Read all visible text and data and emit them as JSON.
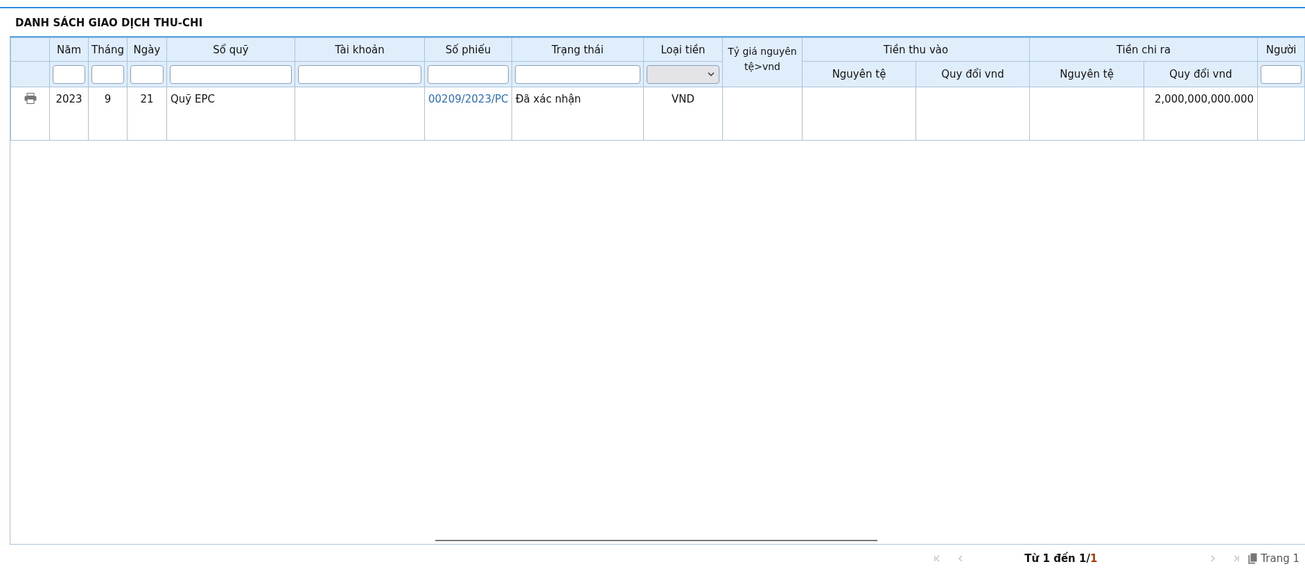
{
  "title": "DANH SÁCH GIAO DỊCH THU-CHI",
  "columns": [
    {
      "kind": "action"
    },
    {
      "kind": "text_filter",
      "label": "Năm"
    },
    {
      "kind": "text_filter",
      "label": "Tháng"
    },
    {
      "kind": "text_filter",
      "label": "Ngày"
    },
    {
      "kind": "text_filter",
      "label": "Sổ quỹ"
    },
    {
      "kind": "text_filter",
      "label": "Tài khoản"
    },
    {
      "kind": "text_filter",
      "label": "Số phiếu"
    },
    {
      "kind": "text_filter",
      "label": "Trạng thái"
    },
    {
      "kind": "select_filter",
      "label": "Loại tiền"
    },
    {
      "kind": "plain",
      "label": "Tỷ giá nguyên tệ>vnd"
    },
    {
      "kind": "group",
      "label": "Tiền thu vào",
      "children": [
        {
          "label": "Nguyên tệ"
        },
        {
          "label": "Quy đổi vnd"
        }
      ]
    },
    {
      "kind": "group",
      "label": "Tiền chi ra",
      "children": [
        {
          "label": "Nguyên tệ"
        },
        {
          "label": "Quy đổi vnd"
        }
      ]
    },
    {
      "kind": "text_filter",
      "label": "Người"
    }
  ],
  "rows": [
    {
      "cells": [
        {
          "kind": "print"
        },
        {
          "kind": "center",
          "text": "2023"
        },
        {
          "kind": "center",
          "text": "9"
        },
        {
          "kind": "center",
          "text": "21"
        },
        {
          "kind": "left",
          "text": "Quỹ EPC"
        },
        {
          "kind": "empty"
        },
        {
          "kind": "link",
          "text": "00209/2023/PC"
        },
        {
          "kind": "left",
          "text": "Đã xác nhận"
        },
        {
          "kind": "center",
          "text": "VND"
        },
        {
          "kind": "empty"
        },
        {
          "kind": "empty"
        },
        {
          "kind": "empty"
        },
        {
          "kind": "empty"
        },
        {
          "kind": "number",
          "text": "2,000,000,000.000"
        },
        {
          "kind": "empty"
        }
      ]
    }
  ],
  "pagination": {
    "first_disabled": true,
    "prev_disabled": true,
    "next_disabled": true,
    "last_disabled": true,
    "range": "Từ 1 đến 1/",
    "total": "1",
    "page": "Trang 1"
  }
}
